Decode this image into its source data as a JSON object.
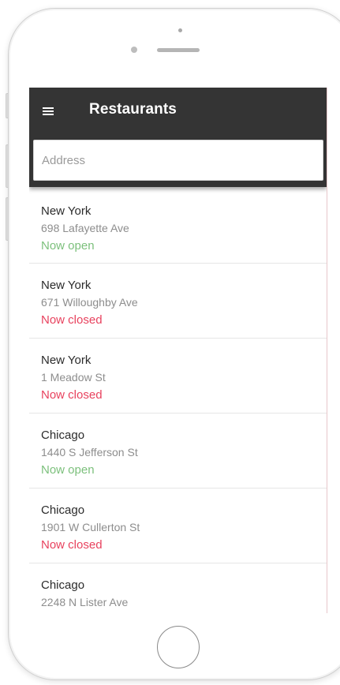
{
  "header": {
    "title": "Restaurants",
    "menu_icon": "hamburger-menu-icon"
  },
  "search": {
    "placeholder": "Address",
    "value": ""
  },
  "colors": {
    "app_bar": "#343434",
    "open": "#7cc07c",
    "closed": "#e8425e"
  },
  "restaurants": [
    {
      "city": "New York",
      "address": "698 Lafayette Ave",
      "status": "Now open",
      "state": "open"
    },
    {
      "city": "New York",
      "address": "671 Willoughby Ave",
      "status": "Now closed",
      "state": "closed"
    },
    {
      "city": "New York",
      "address": "1 Meadow St",
      "status": "Now closed",
      "state": "closed"
    },
    {
      "city": "Chicago",
      "address": "1440 S Jefferson St",
      "status": "Now open",
      "state": "open"
    },
    {
      "city": "Chicago",
      "address": "1901 W Cullerton St",
      "status": "Now closed",
      "state": "closed"
    },
    {
      "city": "Chicago",
      "address": "2248 N Lister Ave",
      "status": "",
      "state": "unknown"
    }
  ]
}
